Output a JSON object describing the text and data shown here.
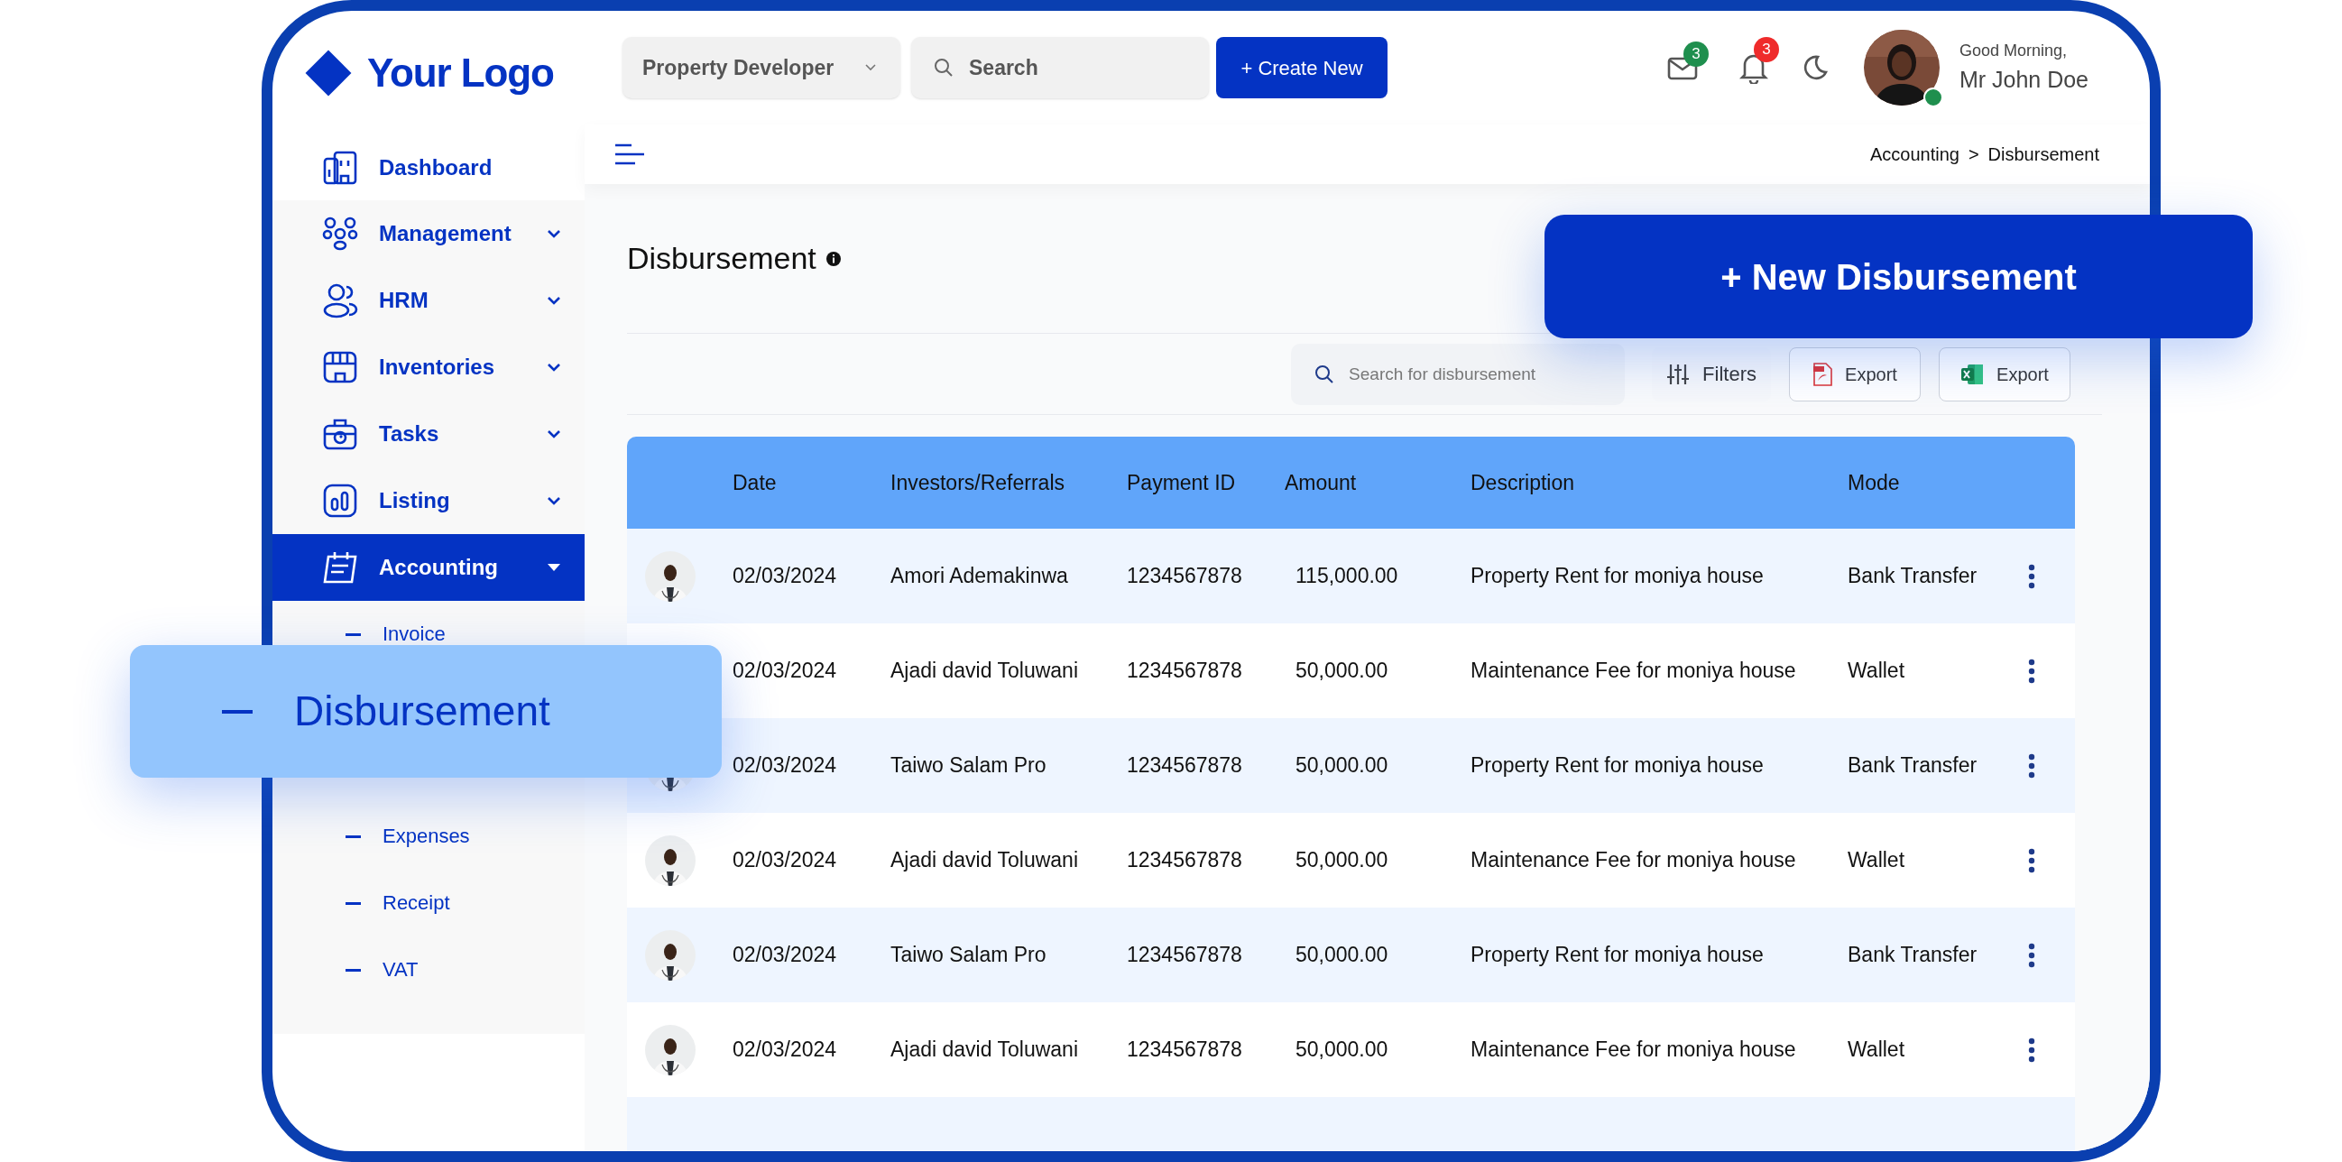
{
  "logo": {
    "text": "Your Logo"
  },
  "header": {
    "role_dropdown": {
      "value": "Property Developer"
    },
    "search": {
      "placeholder": "Search"
    },
    "create_button": "+ Create New",
    "mail": {
      "badge": "3"
    },
    "notifications": {
      "badge": "3"
    },
    "greeting": "Good Morning,",
    "user_name": "Mr John Doe",
    "user_online": true
  },
  "breadcrumb": {
    "items": [
      "Accounting",
      "Disbursement"
    ],
    "separator": ">"
  },
  "sidebar": {
    "items": [
      {
        "label": "Dashboard",
        "selected": false
      },
      {
        "label": "Management",
        "selected": false,
        "expanded": false
      },
      {
        "label": "HRM",
        "selected": false,
        "expanded": false
      },
      {
        "label": "Inventories",
        "selected": false,
        "expanded": false
      },
      {
        "label": "Tasks",
        "selected": false,
        "expanded": false
      },
      {
        "label": "Listing",
        "selected": false,
        "expanded": false
      },
      {
        "label": "Accounting",
        "selected": true,
        "expanded": true,
        "children": [
          {
            "label": "Invoice"
          },
          {
            "label": "Expenses"
          },
          {
            "label": "Receipt"
          },
          {
            "label": "VAT"
          }
        ]
      }
    ]
  },
  "callout": {
    "label": "Disbursement"
  },
  "page": {
    "title": "Disbursement",
    "new_button": "+ New Disbursement",
    "toolbar": {
      "search": {
        "placeholder": "Search for disbursement"
      },
      "filters": "Filters",
      "exports": [
        {
          "kind": "pdf",
          "label": "Export"
        },
        {
          "kind": "excel",
          "label": "Export"
        }
      ]
    },
    "table": {
      "columns": [
        "Date",
        "Investors/Referrals",
        "Payment ID",
        "Amount",
        "Description",
        "Mode"
      ],
      "rows": [
        [
          "02/03/2024",
          "Amori Ademakinwa",
          "1234567878",
          "115,000.00",
          "Property Rent for moniya house",
          "Bank Transfer"
        ],
        [
          "02/03/2024",
          "Ajadi david Toluwani",
          "1234567878",
          "50,000.00",
          "Maintenance Fee for moniya house",
          "Wallet"
        ],
        [
          "02/03/2024",
          "Taiwo Salam Pro",
          "1234567878",
          "50,000.00",
          "Property Rent for moniya house",
          "Bank Transfer"
        ],
        [
          "02/03/2024",
          "Ajadi david Toluwani",
          "1234567878",
          "50,000.00",
          "Maintenance Fee for moniya house",
          "Wallet"
        ],
        [
          "02/03/2024",
          "Taiwo Salam Pro",
          "1234567878",
          "50,000.00",
          "Property Rent for moniya house",
          "Bank Transfer"
        ],
        [
          "02/03/2024",
          "Ajadi david Toluwani",
          "1234567878",
          "50,000.00",
          "Maintenance Fee for moniya house",
          "Wallet"
        ]
      ]
    }
  }
}
